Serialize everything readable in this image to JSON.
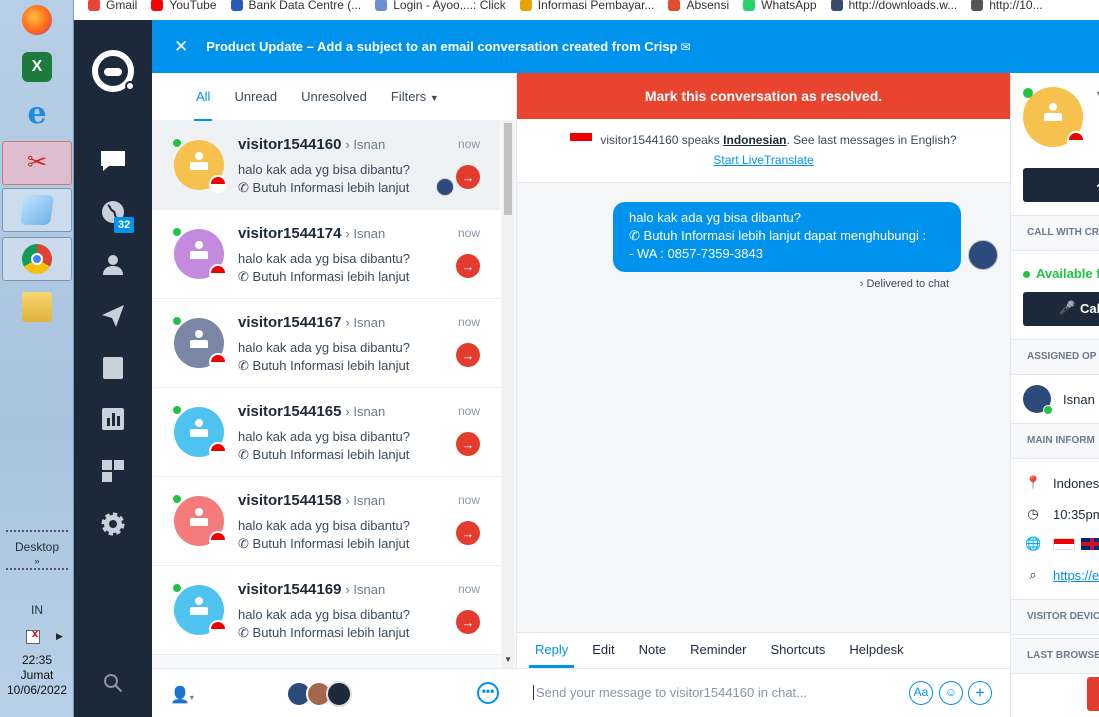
{
  "bookmarks": [
    {
      "label": "Gmail",
      "color": "#ea4335"
    },
    {
      "label": "YouTube",
      "color": "#ff0000"
    },
    {
      "label": "Bank Data Centre (...",
      "color": "#2a5bbb"
    },
    {
      "label": "Login - Ayoo....: Click",
      "color": "#6a8fd0"
    },
    {
      "label": "Informasi Pembayar...",
      "color": "#e8a300"
    },
    {
      "label": "Absensi",
      "color": "#e04e2f"
    },
    {
      "label": "WhatsApp",
      "color": "#25d366"
    },
    {
      "label": "http://downloads.w...",
      "color": "#3c4a6a"
    },
    {
      "label": "http://10...",
      "color": "#555555"
    }
  ],
  "taskbar": {
    "desktop_label": "Desktop",
    "lang": "IN",
    "time": "22:35",
    "day": "Jumat",
    "date": "10/06/2022"
  },
  "nav": {
    "badge_count": "32"
  },
  "banner": {
    "text": "Product Update – Add a subject to an email conversation created from Crisp"
  },
  "list": {
    "tabs": [
      "All",
      "Unread",
      "Unresolved",
      "Filters"
    ],
    "conversations": [
      {
        "name": "visitor1544160",
        "agent": "Isnan",
        "time": "now",
        "line1": "halo kak ada yg bisa dibantu?",
        "line2": "Butuh Informasi lebih lanjut",
        "color": "#f7c14e"
      },
      {
        "name": "visitor1544174",
        "agent": "Isnan",
        "time": "now",
        "line1": "halo kak ada yg bisa dibantu?",
        "line2": "Butuh Informasi lebih lanjut",
        "color": "#c48ae0"
      },
      {
        "name": "visitor1544167",
        "agent": "Isnan",
        "time": "now",
        "line1": "halo kak ada yg bisa dibantu?",
        "line2": "Butuh Informasi lebih lanjut",
        "color": "#7a86a6"
      },
      {
        "name": "visitor1544165",
        "agent": "Isnan",
        "time": "now",
        "line1": "halo kak ada yg bisa dibantu?",
        "line2": "Butuh Informasi lebih lanjut",
        "color": "#4fc3f0"
      },
      {
        "name": "visitor1544158",
        "agent": "Isnan",
        "time": "now",
        "line1": "halo kak ada yg bisa dibantu?",
        "line2": "Butuh Informasi lebih lanjut",
        "color": "#f37b7b"
      },
      {
        "name": "visitor1544169",
        "agent": "Isnan",
        "time": "now",
        "line1": "halo kak ada yg bisa dibantu?",
        "line2": "Butuh Informasi lebih lanjut",
        "color": "#4fc3f0"
      }
    ]
  },
  "chat": {
    "resolve_label": "Mark this conversation as resolved.",
    "translate_prefix": "visitor1544160 speaks",
    "translate_lang": "Indonesian",
    "translate_suffix": ". See last messages in English?",
    "translate_link": "Start LiveTranslate",
    "message_line1": "halo kak ada yg bisa dibantu?",
    "message_line2": "Butuh Informasi lebih lanjut dapat menghubungi :",
    "message_line3": "- WA : 0857-7359-3843",
    "delivered": "Delivered to chat",
    "composer_tabs": [
      "Reply",
      "Edit",
      "Note",
      "Reminder",
      "Shortcuts",
      "Helpdesk"
    ],
    "composer_placeholder": "Send your message to visitor1544160 in chat..."
  },
  "right": {
    "button_text": "↗",
    "call_section": "CALL WITH CR",
    "available": "Available f",
    "call_button": "Cal",
    "assigned_section": "ASSIGNED OP",
    "agent_name": "Isnan",
    "main_section": "MAIN INFORM",
    "location": "Indonesi",
    "local_time": "10:35pm",
    "website": "https://e",
    "device_section": "VISITOR DEVIC",
    "browsed_section": "LAST BROWSE"
  }
}
